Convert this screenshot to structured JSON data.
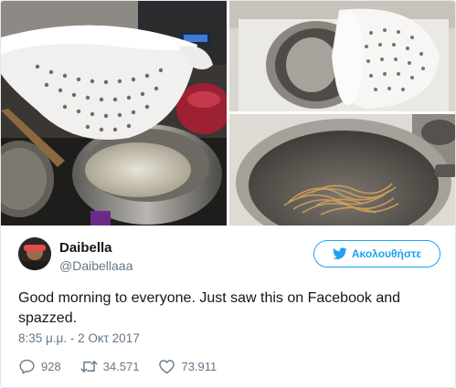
{
  "tweet": {
    "user": {
      "display_name": "Daibella",
      "handle": "@Daibellaaa"
    },
    "follow_button": {
      "label": "Ακολουθήστε",
      "icon": "twitter-bird-icon"
    },
    "text": "Good morning to everyone. Just saw this on Facebook and spazzed.",
    "timestamp": "8:35 μ.μ. - 2 Οκτ 2017",
    "actions": {
      "replies": {
        "count": "928",
        "icon": "reply-icon"
      },
      "retweets": {
        "count": "34.571",
        "icon": "retweet-icon"
      },
      "likes": {
        "count": "73.911",
        "icon": "heart-icon"
      }
    }
  },
  "colors": {
    "accent": "#1da1f2",
    "secondary_text": "#657786",
    "primary_text": "#14171a",
    "border": "#e1e8ed"
  }
}
